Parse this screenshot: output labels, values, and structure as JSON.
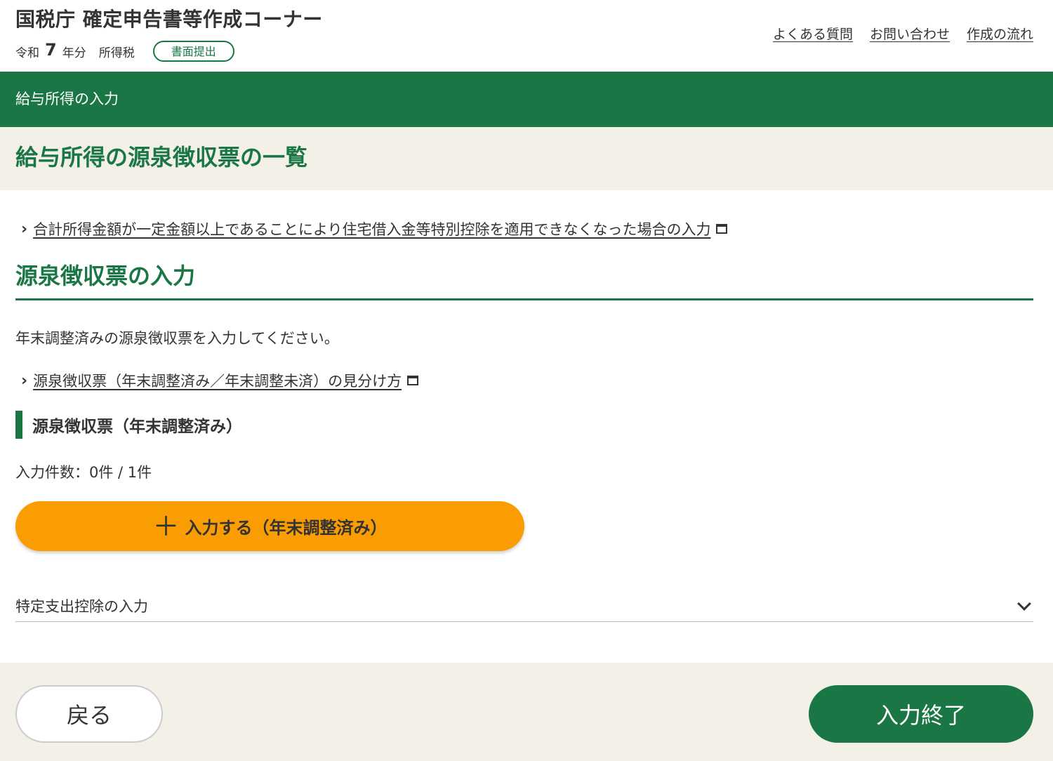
{
  "header": {
    "site_title": "国税庁 確定申告書等作成コーナー",
    "era": "令和",
    "year": "7",
    "year_suffix": "年分",
    "tax_type": "所得税",
    "badge": "書面提出",
    "links": [
      "よくある質問",
      "お問い合わせ",
      "作成の流れ"
    ]
  },
  "green_bar": {
    "label": "給与所得の入力"
  },
  "page_title": "給与所得の源泉徴収票の一覧",
  "main": {
    "link_housing": "合計所得金額が一定金額以上であることにより住宅借入金等特別控除を適用できなくなった場合の入力",
    "section_heading": "源泉徴収票の入力",
    "instruction": "年末調整済みの源泉徴収票を入力してください。",
    "link_distinguish": "源泉徴収票（年末調整済み／年末調整未済）の見分け方",
    "sub_heading": "源泉徴収票（年末調整済み）",
    "count": "入力件数：0件 / 1件",
    "add_button": "入力する（年末調整済み）",
    "accordion_label": "特定支出控除の入力"
  },
  "footer": {
    "back_button": "戻る",
    "finish_button": "入力終了"
  },
  "colors": {
    "primary_green": "#1a7745",
    "accent_orange": "#f99d03",
    "beige": "#f3f0e7"
  },
  "icons": [
    "chevron-right-icon",
    "external-window-icon",
    "plus-icon",
    "chevron-down-icon"
  ]
}
